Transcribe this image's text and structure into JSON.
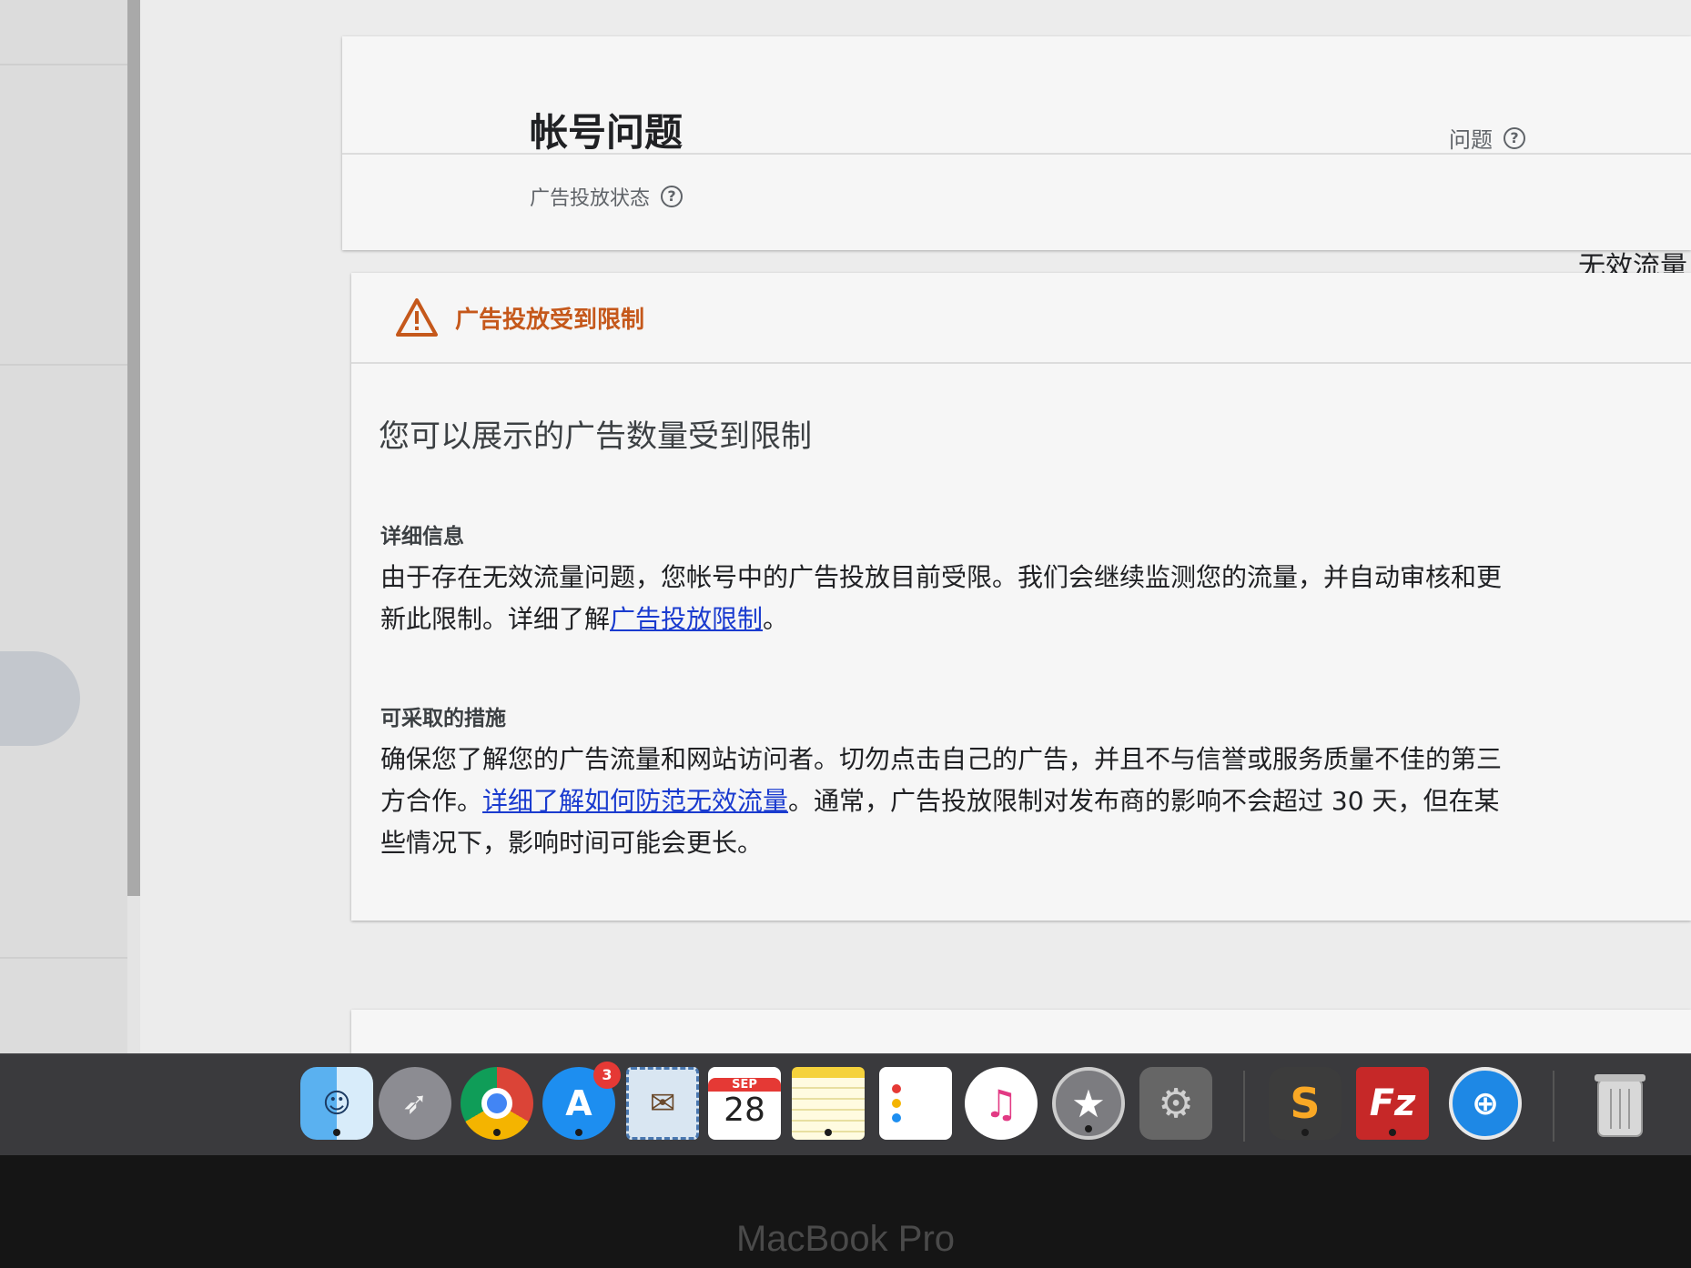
{
  "account_card": {
    "title": "帐号问题",
    "status_label": "广告投放状态",
    "issue_label": "问题"
  },
  "issue_type": "无效流量问题",
  "restriction_card": {
    "banner": "广告投放受到限制",
    "headline": "您可以展示的广告数量受到限制",
    "details_title": "详细信息",
    "details_text_1": "由于存在无效流量问题，您帐号中的广告投放目前受限。我们会继续监测您的流量，并自动审核和更新此限制。详细了解",
    "details_link": "广告投放限制",
    "details_text_2": "。",
    "actions_title": "可采取的措施",
    "actions_text_1": "确保您了解您的广告流量和网站访问者。切勿点击自己的广告，并且不与信誉或服务质量不佳的第三方合作。",
    "actions_link": "详细了解如何防范无效流量",
    "actions_text_2": "。通常，广告投放限制对发布商的影响不会超过 30 天，但在某些情况下，影响时间可能会更长。"
  },
  "dock": {
    "app_store_badge": "3",
    "calendar_month": "SEP",
    "calendar_day": "28",
    "apps": [
      "finder-icon",
      "launchpad-icon",
      "chrome-icon",
      "app-store-icon",
      "mail-icon",
      "calendar-icon",
      "notes-icon",
      "reminders-icon",
      "music-icon",
      "imovie-icon",
      "system-preferences-icon",
      "sublime-text-icon",
      "filezilla-icon",
      "safari-icon",
      "trash-icon"
    ]
  },
  "bezel_label": "MacBook Pro",
  "colors": {
    "warning": "#c5581b",
    "link": "#1a3bcf",
    "dock": "#3a3a3d"
  }
}
